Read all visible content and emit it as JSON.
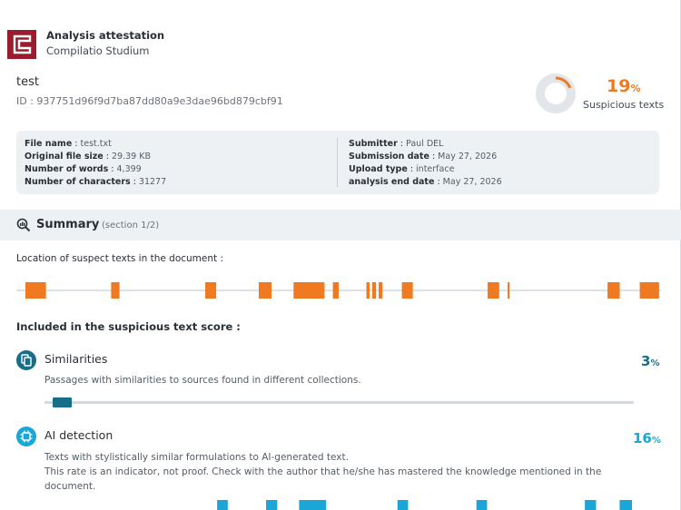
{
  "header": {
    "title": "Analysis attestation",
    "subtitle": "Compilatio Studium",
    "brand_color": "#9b1c2e"
  },
  "document": {
    "name": "test",
    "id_label": "ID : ",
    "id": "937751d96f9d7ba87dd80a9e3dae96bd879cbf91"
  },
  "score": {
    "value": "19",
    "unit": "%",
    "fraction": 0.19,
    "label": "Suspicious texts",
    "color": "#f07a22"
  },
  "info": {
    "left": [
      {
        "label": "File name",
        "value": "test.txt"
      },
      {
        "label": "Original file size",
        "value": "29.39 KB"
      },
      {
        "label": "Number of words",
        "value": "4,399"
      },
      {
        "label": "Number of characters",
        "value": "31277"
      }
    ],
    "right": [
      {
        "label": "Submitter",
        "value": "Paul DEL"
      },
      {
        "label": "Submission date",
        "value": "May 27, 2026"
      },
      {
        "label": "Upload type",
        "value": "interface"
      },
      {
        "label": "analysis end date",
        "value": "May 27, 2026"
      }
    ]
  },
  "summary": {
    "title": "Summary",
    "section": "(section 1/2)",
    "location_label": "Location of suspect texts in the document :",
    "included_label": "Included in the suspicious text score :",
    "location_marks": [
      [
        0.014,
        0.046
      ],
      [
        0.147,
        0.16
      ],
      [
        0.293,
        0.31
      ],
      [
        0.376,
        0.396
      ],
      [
        0.43,
        0.478
      ],
      [
        0.491,
        0.5
      ],
      [
        0.543,
        0.548
      ],
      [
        0.552,
        0.558
      ],
      [
        0.562,
        0.568
      ],
      [
        0.598,
        0.615
      ],
      [
        0.731,
        0.749
      ],
      [
        0.762,
        0.765
      ],
      [
        0.917,
        0.936
      ],
      [
        0.967,
        0.997
      ],
      [
        0.971,
        0.975
      ]
    ]
  },
  "similarities": {
    "title": "Similarities",
    "description": "Passages with similarities to sources found in different collections.",
    "value": "3",
    "unit": "%",
    "color": "#176e88",
    "marks": [
      [
        0.014,
        0.047
      ]
    ]
  },
  "ai_detection": {
    "title": "AI detection",
    "description_1": "Texts with stylistically similar formulations to AI-generated text.",
    "description_2": "This rate is an indicator, not proof. Check with the author that he/she has mastered the knowledge mentioned in the",
    "description_3": "document.",
    "value": "16",
    "unit": "%",
    "color": "#1aa6d6",
    "marks": [
      [
        0.293,
        0.311
      ],
      [
        0.376,
        0.395
      ],
      [
        0.432,
        0.478
      ],
      [
        0.599,
        0.617
      ],
      [
        0.733,
        0.751
      ],
      [
        0.917,
        0.936
      ],
      [
        0.976,
        0.997
      ]
    ]
  }
}
